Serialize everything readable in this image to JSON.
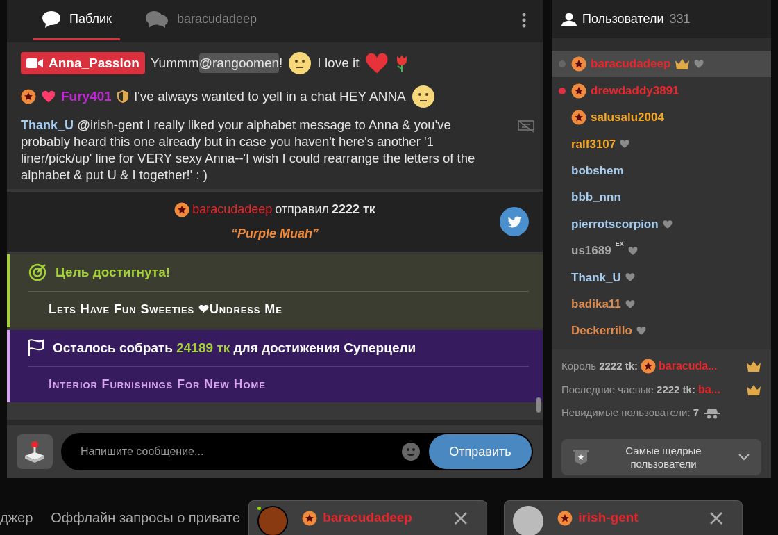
{
  "chat": {
    "tabs": [
      {
        "label": "Паблик",
        "selected": true,
        "kind": "public"
      },
      {
        "label": "baracudadeep",
        "selected": false,
        "kind": "private"
      }
    ],
    "messages": [
      {
        "kind": "broadcaster",
        "user": "Anna_Passion",
        "text": "Yummm",
        "mention": "@rangoomen",
        "after": "!",
        "text2": "I love it"
      },
      {
        "kind": "user",
        "user": "Fury401",
        "color": "#c026d3",
        "text": "I've always wanted to yell in a chat HEY ANNA"
      },
      {
        "kind": "reply",
        "user": "Thank_U",
        "color": "#a6cdf0",
        "mention": "@irish-gent",
        "text": "I really liked your alphabet message to Anna & you've probably heard this one already but in case you haven't here's another '1 liner/pick/up' line for VERY sexy Anna--'I wish I could rearrange the letters of the alphabet & put U & I together!' : )"
      },
      {
        "kind": "tip",
        "user": "baracudadeep",
        "verb": "отправил",
        "amount": "2222 тк",
        "note": "“Purple Muah”"
      },
      {
        "kind": "goal",
        "title": "Цель достигнута!",
        "text": "Lets Have Fun Sweeties ❤Undress Me"
      },
      {
        "kind": "supergoal",
        "before": "Осталось собрать",
        "amount": "24189 тк",
        "after": "для достижения Суперцели",
        "text": "Interior Furnishings For New Home"
      }
    ],
    "input": {
      "placeholder": "Напишите сообщение...",
      "send": "Отправить"
    }
  },
  "users": {
    "title": "Пользователи",
    "count": "331",
    "list": [
      {
        "name": "baracudadeep",
        "color": "#e8262b",
        "dot": {
          "color": "#666666"
        },
        "badge": true,
        "crown": true,
        "heart": true,
        "selected": true
      },
      {
        "name": "drewdaddy3891",
        "color": "#e8262b",
        "dot": {
          "color": "#e03040"
        },
        "badge": true,
        "crown": false,
        "heart": false,
        "selected": false
      },
      {
        "name": "salusalu2004",
        "color": "#f5a623",
        "badge": true,
        "crown": false,
        "heart": false,
        "selected": false
      },
      {
        "name": "ralf3107",
        "color": "#f5a623",
        "badge": false,
        "crown": false,
        "heart": true,
        "selected": false
      },
      {
        "name": "bobshem",
        "color": "#a6cdf0",
        "badge": false,
        "crown": false,
        "heart": false,
        "selected": false
      },
      {
        "name": "bbb_nnn",
        "color": "#a6cdf0",
        "badge": false,
        "crown": false,
        "heart": false,
        "selected": false
      },
      {
        "name": "pierrotscorpion",
        "color": "#a6cdf0",
        "badge": false,
        "crown": false,
        "heart": true,
        "selected": false
      },
      {
        "name": "us1689",
        "sup": "EX",
        "color": "#a8a8a8",
        "badge": false,
        "crown": false,
        "heart": true,
        "selected": false
      },
      {
        "name": "Thank_U",
        "color": "#a6cdf0",
        "badge": false,
        "crown": false,
        "heart": true,
        "selected": false
      },
      {
        "name": "badika11",
        "color": "#e08a4b",
        "badge": false,
        "crown": false,
        "heart": true,
        "selected": false
      },
      {
        "name": "Deckerrillo",
        "color": "#e08a4b",
        "badge": false,
        "crown": false,
        "heart": true,
        "selected": false
      }
    ],
    "king": {
      "label": "Король",
      "amount": "2222 tk:",
      "user": "baracuda..."
    },
    "last_tip": {
      "label": "Последние чаевые",
      "amount": "2222 tk:",
      "user": "ba..."
    },
    "invisible": {
      "label": "Невидимые пользователи:",
      "count": "7"
    },
    "top_button": "Самые щедрые пользователи"
  },
  "bottom": {
    "links": [
      "джер",
      "Оффлайн запросы о привате"
    ],
    "chats": [
      {
        "user": "baracudadeep",
        "online": true
      },
      {
        "user": "irish-gent",
        "online": false
      }
    ]
  }
}
